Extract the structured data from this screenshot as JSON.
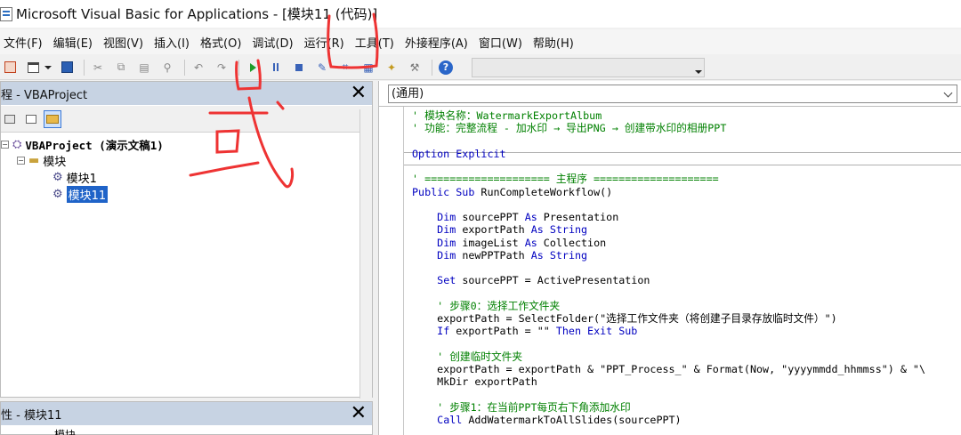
{
  "window": {
    "title": "Microsoft Visual Basic for Applications - [模块11 (代码)]"
  },
  "menu": [
    "文件(F)",
    "编辑(E)",
    "视图(V)",
    "插入(I)",
    "格式(O)",
    "调试(D)",
    "运行(R)",
    "工具(T)",
    "外接程序(A)",
    "窗口(W)",
    "帮助(H)"
  ],
  "toolbar": {
    "icons": [
      "powerpoint-view-icon",
      "insert-userform-icon",
      "save-icon",
      "cut-icon",
      "copy-icon",
      "paste-icon",
      "find-icon",
      "undo-icon",
      "redo-icon",
      "run-icon",
      "break-icon",
      "reset-icon",
      "design-mode-icon",
      "project-explorer-icon",
      "properties-icon",
      "object-browser-icon",
      "toolbox-icon",
      "help-icon"
    ],
    "help_glyph": "?",
    "position_box": ""
  },
  "project_pane": {
    "title": "程 - VBAProject",
    "close_glyph": "✕",
    "tree": [
      {
        "label": "VBAProject (演示文稿1)",
        "level": 0,
        "expander": "−"
      },
      {
        "label": "模块",
        "level": 1,
        "expander": "−"
      },
      {
        "label": "模块1",
        "level": 2
      },
      {
        "label": "模块11",
        "level": 2,
        "selected": true
      }
    ]
  },
  "properties_pane": {
    "title": "性 - 模块11",
    "close_glyph": "✕",
    "partial_text": "模块"
  },
  "code_window": {
    "object_combo": "(通用)",
    "lines": [
      [
        {
          "t": "' 模块名称：WatermarkExportAlbum",
          "c": "cm"
        }
      ],
      [
        {
          "t": "' 功能：完整流程 - 加水印 → 导出PNG → 创建带水印的相册PPT",
          "c": "cm"
        }
      ],
      [],
      [
        {
          "t": "Option Explicit",
          "c": "kw"
        }
      ],
      [],
      [
        {
          "t": "' ==================== 主程序 ====================",
          "c": "cm"
        }
      ],
      [
        {
          "t": "Public Sub",
          "c": "kw"
        },
        {
          "t": " RunCompleteWorkflow()",
          "c": ""
        }
      ],
      [],
      [
        {
          "t": "    ",
          "c": ""
        },
        {
          "t": "Dim",
          "c": "kw"
        },
        {
          "t": " sourcePPT ",
          "c": ""
        },
        {
          "t": "As",
          "c": "kw"
        },
        {
          "t": " Presentation",
          "c": ""
        }
      ],
      [
        {
          "t": "    ",
          "c": ""
        },
        {
          "t": "Dim",
          "c": "kw"
        },
        {
          "t": " exportPath ",
          "c": ""
        },
        {
          "t": "As",
          "c": "kw"
        },
        {
          "t": " ",
          "c": ""
        },
        {
          "t": "String",
          "c": "kw"
        }
      ],
      [
        {
          "t": "    ",
          "c": ""
        },
        {
          "t": "Dim",
          "c": "kw"
        },
        {
          "t": " imageList ",
          "c": ""
        },
        {
          "t": "As",
          "c": "kw"
        },
        {
          "t": " Collection",
          "c": ""
        }
      ],
      [
        {
          "t": "    ",
          "c": ""
        },
        {
          "t": "Dim",
          "c": "kw"
        },
        {
          "t": " newPPTPath ",
          "c": ""
        },
        {
          "t": "As",
          "c": "kw"
        },
        {
          "t": " ",
          "c": ""
        },
        {
          "t": "String",
          "c": "kw"
        }
      ],
      [],
      [
        {
          "t": "    ",
          "c": ""
        },
        {
          "t": "Set",
          "c": "kw"
        },
        {
          "t": " sourcePPT = ActivePresentation",
          "c": ""
        }
      ],
      [],
      [
        {
          "t": "    ' 步骤0：选择工作文件夹",
          "c": "cm"
        }
      ],
      [
        {
          "t": "    exportPath = SelectFolder(\"选择工作文件夹（将创建子目录存放临时文件）\")",
          "c": ""
        }
      ],
      [
        {
          "t": "    ",
          "c": ""
        },
        {
          "t": "If",
          "c": "kw"
        },
        {
          "t": " exportPath = \"\" ",
          "c": ""
        },
        {
          "t": "Then Exit Sub",
          "c": "kw"
        }
      ],
      [],
      [
        {
          "t": "    ' 创建临时文件夹",
          "c": "cm"
        }
      ],
      [
        {
          "t": "    exportPath = exportPath & \"PPT_Process_\" & Format(Now, \"yyyymmdd_hhmmss\") & \"\\",
          "c": ""
        }
      ],
      [
        {
          "t": "    MkDir exportPath",
          "c": ""
        }
      ],
      [],
      [
        {
          "t": "    ' 步骤1：在当前PPT每页右下角添加水印",
          "c": "cm"
        }
      ],
      [
        {
          "t": "    ",
          "c": ""
        },
        {
          "t": "Call",
          "c": "kw"
        },
        {
          "t": " AddWatermarkToAllSlides(sourcePPT)",
          "c": ""
        }
      ]
    ]
  },
  "annotations": {
    "color": "#ee3333",
    "handwritten_text": "或"
  }
}
